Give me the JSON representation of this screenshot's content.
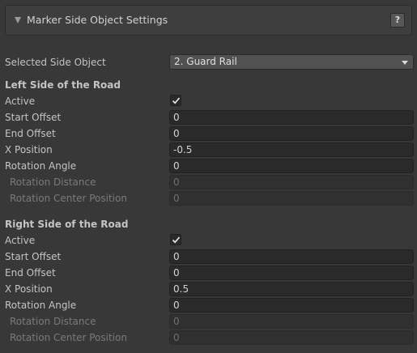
{
  "header": {
    "title": "Marker Side Object Settings",
    "help_label": "?"
  },
  "selected_side_object": {
    "label": "Selected Side Object",
    "value": "2.  Guard Rail"
  },
  "left": {
    "section": "Left Side of the Road",
    "active_label": "Active",
    "active_checked": true,
    "start_offset": {
      "label": "Start Offset",
      "value": "0"
    },
    "end_offset": {
      "label": "End Offset",
      "value": "0"
    },
    "x_position": {
      "label": "X Position",
      "value": "-0.5"
    },
    "rotation_angle": {
      "label": "Rotation Angle",
      "value": "0"
    },
    "rotation_distance": {
      "label": "Rotation Distance",
      "value": "0"
    },
    "rotation_center_position": {
      "label": "Rotation Center Position",
      "value": "0"
    }
  },
  "right": {
    "section": "Right Side of the Road",
    "active_label": "Active",
    "active_checked": true,
    "start_offset": {
      "label": "Start Offset",
      "value": "0"
    },
    "end_offset": {
      "label": "End Offset",
      "value": "0"
    },
    "x_position": {
      "label": "X Position",
      "value": "0.5"
    },
    "rotation_angle": {
      "label": "Rotation Angle",
      "value": "0"
    },
    "rotation_distance": {
      "label": "Rotation Distance",
      "value": "0"
    },
    "rotation_center_position": {
      "label": "Rotation Center Position",
      "value": "0"
    }
  }
}
